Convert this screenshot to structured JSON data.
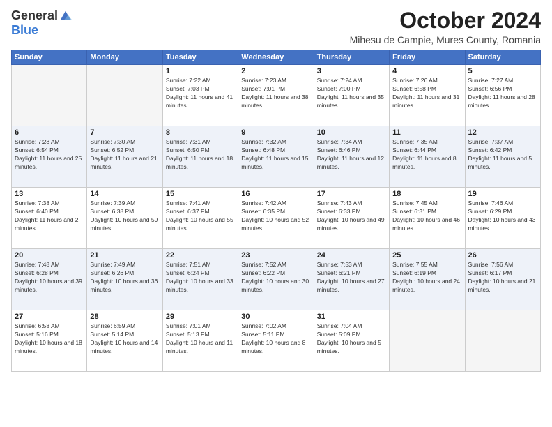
{
  "logo": {
    "general": "General",
    "blue": "Blue"
  },
  "title": "October 2024",
  "location": "Mihesu de Campie, Mures County, Romania",
  "days_of_week": [
    "Sunday",
    "Monday",
    "Tuesday",
    "Wednesday",
    "Thursday",
    "Friday",
    "Saturday"
  ],
  "weeks": [
    [
      {
        "day": "",
        "empty": true
      },
      {
        "day": "",
        "empty": true
      },
      {
        "day": "1",
        "sunrise": "7:22 AM",
        "sunset": "7:03 PM",
        "daylight": "11 hours and 41 minutes."
      },
      {
        "day": "2",
        "sunrise": "7:23 AM",
        "sunset": "7:01 PM",
        "daylight": "11 hours and 38 minutes."
      },
      {
        "day": "3",
        "sunrise": "7:24 AM",
        "sunset": "7:00 PM",
        "daylight": "11 hours and 35 minutes."
      },
      {
        "day": "4",
        "sunrise": "7:26 AM",
        "sunset": "6:58 PM",
        "daylight": "11 hours and 31 minutes."
      },
      {
        "day": "5",
        "sunrise": "7:27 AM",
        "sunset": "6:56 PM",
        "daylight": "11 hours and 28 minutes."
      }
    ],
    [
      {
        "day": "6",
        "sunrise": "7:28 AM",
        "sunset": "6:54 PM",
        "daylight": "11 hours and 25 minutes."
      },
      {
        "day": "7",
        "sunrise": "7:30 AM",
        "sunset": "6:52 PM",
        "daylight": "11 hours and 21 minutes."
      },
      {
        "day": "8",
        "sunrise": "7:31 AM",
        "sunset": "6:50 PM",
        "daylight": "11 hours and 18 minutes."
      },
      {
        "day": "9",
        "sunrise": "7:32 AM",
        "sunset": "6:48 PM",
        "daylight": "11 hours and 15 minutes."
      },
      {
        "day": "10",
        "sunrise": "7:34 AM",
        "sunset": "6:46 PM",
        "daylight": "11 hours and 12 minutes."
      },
      {
        "day": "11",
        "sunrise": "7:35 AM",
        "sunset": "6:44 PM",
        "daylight": "11 hours and 8 minutes."
      },
      {
        "day": "12",
        "sunrise": "7:37 AM",
        "sunset": "6:42 PM",
        "daylight": "11 hours and 5 minutes."
      }
    ],
    [
      {
        "day": "13",
        "sunrise": "7:38 AM",
        "sunset": "6:40 PM",
        "daylight": "11 hours and 2 minutes."
      },
      {
        "day": "14",
        "sunrise": "7:39 AM",
        "sunset": "6:38 PM",
        "daylight": "10 hours and 59 minutes."
      },
      {
        "day": "15",
        "sunrise": "7:41 AM",
        "sunset": "6:37 PM",
        "daylight": "10 hours and 55 minutes."
      },
      {
        "day": "16",
        "sunrise": "7:42 AM",
        "sunset": "6:35 PM",
        "daylight": "10 hours and 52 minutes."
      },
      {
        "day": "17",
        "sunrise": "7:43 AM",
        "sunset": "6:33 PM",
        "daylight": "10 hours and 49 minutes."
      },
      {
        "day": "18",
        "sunrise": "7:45 AM",
        "sunset": "6:31 PM",
        "daylight": "10 hours and 46 minutes."
      },
      {
        "day": "19",
        "sunrise": "7:46 AM",
        "sunset": "6:29 PM",
        "daylight": "10 hours and 43 minutes."
      }
    ],
    [
      {
        "day": "20",
        "sunrise": "7:48 AM",
        "sunset": "6:28 PM",
        "daylight": "10 hours and 39 minutes."
      },
      {
        "day": "21",
        "sunrise": "7:49 AM",
        "sunset": "6:26 PM",
        "daylight": "10 hours and 36 minutes."
      },
      {
        "day": "22",
        "sunrise": "7:51 AM",
        "sunset": "6:24 PM",
        "daylight": "10 hours and 33 minutes."
      },
      {
        "day": "23",
        "sunrise": "7:52 AM",
        "sunset": "6:22 PM",
        "daylight": "10 hours and 30 minutes."
      },
      {
        "day": "24",
        "sunrise": "7:53 AM",
        "sunset": "6:21 PM",
        "daylight": "10 hours and 27 minutes."
      },
      {
        "day": "25",
        "sunrise": "7:55 AM",
        "sunset": "6:19 PM",
        "daylight": "10 hours and 24 minutes."
      },
      {
        "day": "26",
        "sunrise": "7:56 AM",
        "sunset": "6:17 PM",
        "daylight": "10 hours and 21 minutes."
      }
    ],
    [
      {
        "day": "27",
        "sunrise": "6:58 AM",
        "sunset": "5:16 PM",
        "daylight": "10 hours and 18 minutes."
      },
      {
        "day": "28",
        "sunrise": "6:59 AM",
        "sunset": "5:14 PM",
        "daylight": "10 hours and 14 minutes."
      },
      {
        "day": "29",
        "sunrise": "7:01 AM",
        "sunset": "5:13 PM",
        "daylight": "10 hours and 11 minutes."
      },
      {
        "day": "30",
        "sunrise": "7:02 AM",
        "sunset": "5:11 PM",
        "daylight": "10 hours and 8 minutes."
      },
      {
        "day": "31",
        "sunrise": "7:04 AM",
        "sunset": "5:09 PM",
        "daylight": "10 hours and 5 minutes."
      },
      {
        "day": "",
        "empty": true
      },
      {
        "day": "",
        "empty": true
      }
    ]
  ]
}
